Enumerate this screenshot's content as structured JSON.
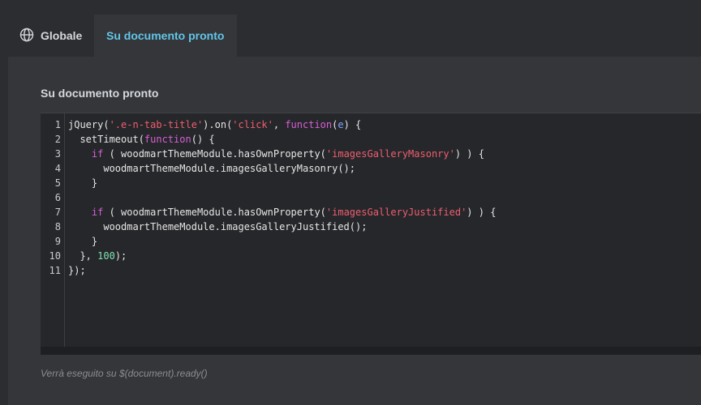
{
  "tabs": [
    {
      "label": "Globale",
      "icon": "globe-icon",
      "active": false
    },
    {
      "label": "Su documento pronto",
      "active": true
    }
  ],
  "section": {
    "title": "Su documento pronto"
  },
  "editor": {
    "line_numbers": [
      "1",
      "2",
      "3",
      "4",
      "5",
      "6",
      "7",
      "8",
      "9",
      "10",
      "11"
    ],
    "lines": [
      [
        {
          "t": "jQuery("
        },
        {
          "t": "'.e-n-tab-title'",
          "c": "s"
        },
        {
          "t": ").on("
        },
        {
          "t": "'click'",
          "c": "s"
        },
        {
          "t": ", "
        },
        {
          "t": "function",
          "c": "k"
        },
        {
          "t": "("
        },
        {
          "t": "e",
          "c": "p"
        },
        {
          "t": ") {"
        }
      ],
      [
        {
          "t": "  setTimeout("
        },
        {
          "t": "function",
          "c": "k"
        },
        {
          "t": "() {"
        }
      ],
      [
        {
          "t": "    "
        },
        {
          "t": "if",
          "c": "k"
        },
        {
          "t": " ( woodmartThemeModule.hasOwnProperty("
        },
        {
          "t": "'imagesGalleryMasonry'",
          "c": "s"
        },
        {
          "t": ") ) {"
        }
      ],
      [
        {
          "t": "      woodmartThemeModule.imagesGalleryMasonry();"
        }
      ],
      [
        {
          "t": "    }"
        }
      ],
      [
        {
          "t": ""
        }
      ],
      [
        {
          "t": "    "
        },
        {
          "t": "if",
          "c": "k"
        },
        {
          "t": " ( woodmartThemeModule.hasOwnProperty("
        },
        {
          "t": "'imagesGalleryJustified'",
          "c": "s"
        },
        {
          "t": ") ) {"
        }
      ],
      [
        {
          "t": "      woodmartThemeModule.imagesGalleryJustified();"
        }
      ],
      [
        {
          "t": "    }"
        }
      ],
      [
        {
          "t": "  }, "
        },
        {
          "t": "100",
          "c": "n"
        },
        {
          "t": ");"
        }
      ],
      [
        {
          "t": "});"
        }
      ]
    ]
  },
  "hint": "Verrà eseguito su $(document).ready()"
}
